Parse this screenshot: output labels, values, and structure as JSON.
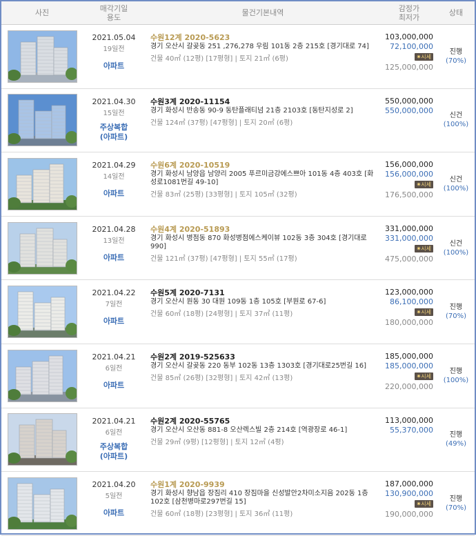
{
  "header": {
    "photo": "사진",
    "date_use": "매각기일\n용도",
    "info": "물건기본내역",
    "price": "감정가\n최저가",
    "status": "상태"
  },
  "colors": {
    "gold": "#b89a52",
    "blue": "#3a6db5",
    "border": "#6f8cc4"
  },
  "badge_label": "시세",
  "rows": [
    {
      "date": "2021.05.04",
      "ago": "19일전",
      "use": "아파트",
      "case": "수원12계 2020-5623",
      "case_style": "gold",
      "address": "경기 오산시 갈곶동 251 ,276,278 우림 101동 2층 215호 [경기대로 74]",
      "sizes": "건물 40㎡ (12평) [17평형]  |  토지 21㎡ (6평)",
      "appraisal": "103,000,000",
      "minimum": "72,100,000",
      "market": "125,000,000",
      "status": "진행",
      "percent": "(70%)"
    },
    {
      "date": "2021.04.30",
      "ago": "15일전",
      "use": "주상복합\n(아파트)",
      "case": "수원3계 2020-11154",
      "case_style": "black",
      "address": "경기 화성시 반송동 90-9 동탄플래티넘 21층 2103호 [동탄지성로 2]",
      "sizes": "건물 124㎡ (37평) [47평형]  |  토지 20㎡ (6평)",
      "appraisal": "550,000,000",
      "minimum": "550,000,000",
      "market": "",
      "status": "신건",
      "percent": "(100%)"
    },
    {
      "date": "2021.04.29",
      "ago": "14일전",
      "use": "아파트",
      "case": "수원6계 2020-10519",
      "case_style": "gold",
      "address": "경기 화성시 남양읍 남양리 2005 푸르미금강에스쁘아 101동 4층 403호 [화성로1081번길 49-10]",
      "sizes": "건물 83㎡ (25평) [33평형]  |  토지 105㎡ (32평)",
      "appraisal": "156,000,000",
      "minimum": "156,000,000",
      "market": "176,500,000",
      "status": "신건",
      "percent": "(100%)"
    },
    {
      "date": "2021.04.28",
      "ago": "13일전",
      "use": "아파트",
      "case": "수원4계 2020-51893",
      "case_style": "gold",
      "address": "경기 화성시 병점동 870 화성병점에스케이뷰 102동 3층 304호 [경기대로 990]",
      "sizes": "건물 121㎡ (37평) [47평형]  |  토지 55㎡ (17평)",
      "appraisal": "331,000,000",
      "minimum": "331,000,000",
      "market": "475,000,000",
      "status": "신건",
      "percent": "(100%)"
    },
    {
      "date": "2021.04.22",
      "ago": "7일전",
      "use": "아파트",
      "case": "수원5계 2020-7131",
      "case_style": "black",
      "address": "경기 오산시 원동 30 대원 109동 1층 105호 [부원로 67-6]",
      "sizes": "건물 60㎡ (18평) [24평형]  |  토지 37㎡ (11평)",
      "appraisal": "123,000,000",
      "minimum": "86,100,000",
      "market": "180,000,000",
      "status": "진행",
      "percent": "(70%)"
    },
    {
      "date": "2021.04.21",
      "ago": "6일전",
      "use": "아파트",
      "case": "수원2계 2019-525633",
      "case_style": "black",
      "address": "경기 오산시 갈곶동 220 동부 102동 13층 1303호 [경기대로25번길 16]",
      "sizes": "건물 85㎡ (26평) [32평형]  |  토지 42㎡ (13평)",
      "appraisal": "185,000,000",
      "minimum": "185,000,000",
      "market": "220,000,000",
      "status": "진행",
      "percent": "(100%)"
    },
    {
      "date": "2021.04.21",
      "ago": "6일전",
      "use": "주상복합\n(아파트)",
      "case": "수원2계 2020-55765",
      "case_style": "black",
      "address": "경기 오산시 오산동 881-8 오산렉스빌 2층 214호 [역광장로 46-1]",
      "sizes": "건물 29㎡ (9평) [12평형]  |  토지 12㎡ (4평)",
      "appraisal": "113,000,000",
      "minimum": "55,370,000",
      "market": "",
      "status": "진행",
      "percent": "(49%)"
    },
    {
      "date": "2021.04.20",
      "ago": "5일전",
      "use": "아파트",
      "case": "수원1계 2020-9939",
      "case_style": "gold",
      "address": "경기 화성시 향남읍 장짐리 410 장짐마을 신성발안2차미소지음 202동 1층 102호 [삼천병마로297번길 15]",
      "sizes": "건물 60㎡ (18평) [23평형]  |  토지 36㎡ (11평)",
      "appraisal": "187,000,000",
      "minimum": "130,900,000",
      "market": "190,000,000",
      "status": "진행",
      "percent": "(70%)"
    }
  ]
}
